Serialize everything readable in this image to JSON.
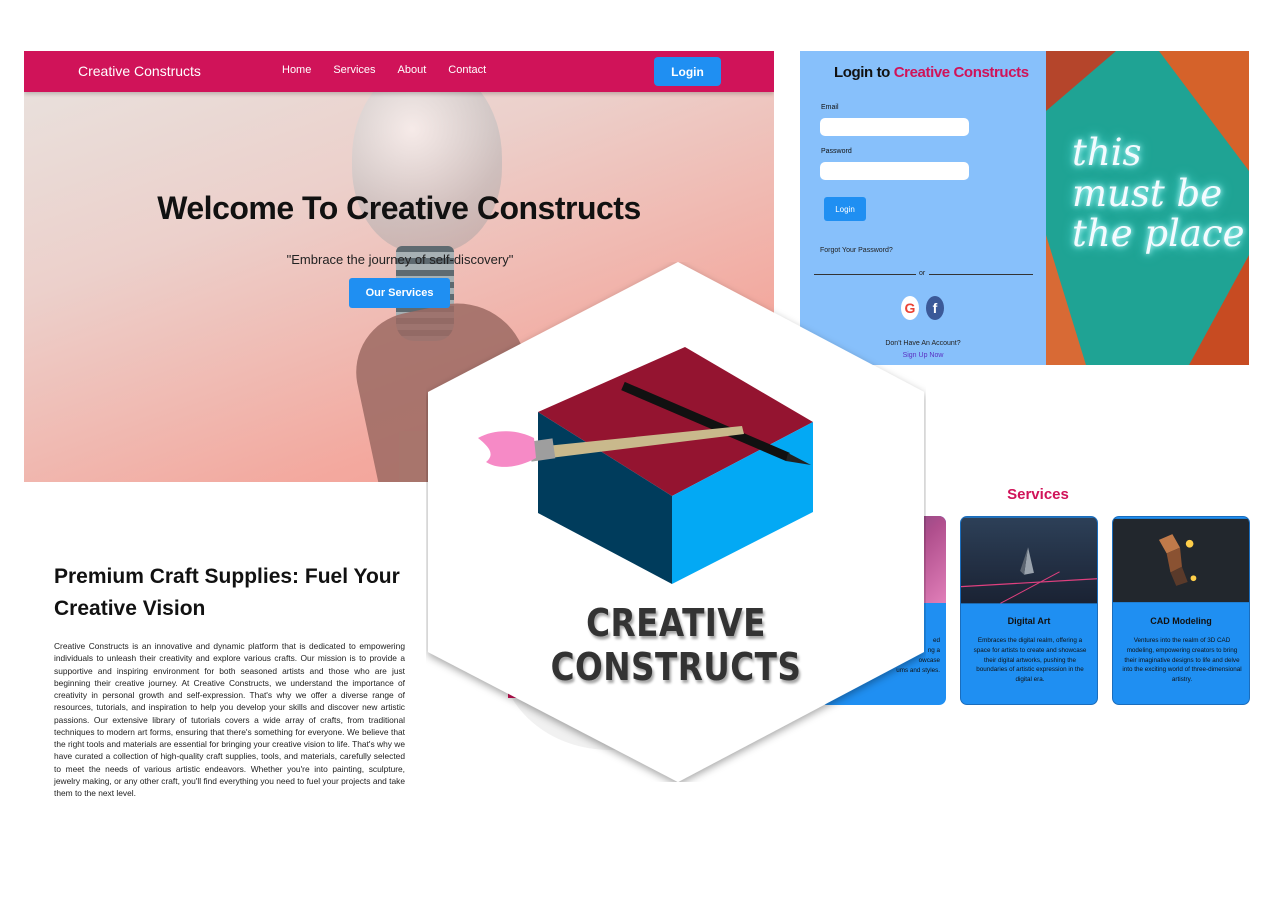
{
  "landing": {
    "brand": "Creative Constructs",
    "nav": [
      "Home",
      "Services",
      "About",
      "Contact"
    ],
    "login_label": "Login",
    "hero_title": "Welcome To Creative Constructs",
    "hero_subtitle": "\"Embrace the journey of self-discovery\"",
    "hero_button": "Our Services"
  },
  "login": {
    "title_prefix": "Login to",
    "title_accent": "Creative Constructs",
    "email_label": "Email",
    "password_label": "Password",
    "button": "Login",
    "forgot": "Forgot Your Password?",
    "or": "or",
    "google_glyph": "G",
    "facebook_glyph": "f",
    "no_account": "Don't Have An Account?",
    "sign_up": "Sign Up Now",
    "neon_lines": [
      "this",
      "must be",
      "the place"
    ]
  },
  "about": {
    "title": "Premium Craft Supplies: Fuel Your Creative Vision",
    "body": "Creative Constructs is an innovative and dynamic platform that is dedicated to empowering individuals to unleash their creativity and explore various crafts. Our mission is to provide a supportive and inspiring environment for both seasoned artists and those who are just beginning their creative journey. At Creative Constructs, we understand the importance of creativity in personal growth and self-expression. That's why we offer a diverse range of resources, tutorials, and inspiration to help you develop your skills and discover new artistic passions. Our extensive library of tutorials covers a wide array of crafts, from traditional techniques to modern art forms, ensuring that there's something for everyone. We believe that the right tools and materials are essential for bringing your creative vision to life. That's why we have curated a collection of high-quality craft supplies, tools, and materials, carefully selected to meet the needs of various artistic endeavors. Whether you're into painting, sculpture, jewelry making, or any other craft, you'll find everything you need to fuel your projects and take them to the next level."
  },
  "services": {
    "title": "Services",
    "partial_card_fragments": [
      "ed",
      "ng a",
      "owcase",
      "ums and styles."
    ],
    "cards": [
      {
        "name": "Digital Art",
        "desc": "Embraces the digital realm, offering a space for artists to create and showcase their digital artworks, pushing the boundaries of artistic expression in the digital era."
      },
      {
        "name": "CAD Modeling",
        "desc": "Ventures into the realm of 3D CAD modeling, empowering creators to bring their imaginative designs to life and delve into the exciting world of three-dimensional artistry."
      }
    ]
  },
  "logo": {
    "text": "CREATIVE CONSTRUCTS"
  },
  "colors": {
    "brand_pink": "#d01359",
    "button_blue": "#1f8ff2",
    "login_bg": "#87c0fb",
    "cube_top": "#941430",
    "cube_left": "#003c5c",
    "cube_right": "#03a9f4"
  }
}
